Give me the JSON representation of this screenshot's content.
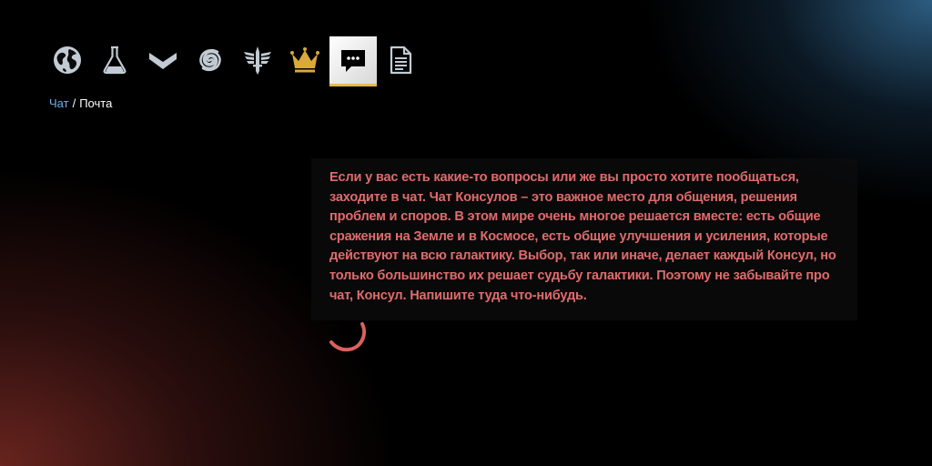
{
  "toolbar": {
    "items": [
      {
        "name": "globe-icon",
        "active": false
      },
      {
        "name": "flask-icon",
        "active": false
      },
      {
        "name": "chevron-rank-icon",
        "active": false
      },
      {
        "name": "spiral-galaxy-icon",
        "active": false
      },
      {
        "name": "winged-sword-icon",
        "active": false
      },
      {
        "name": "crown-icon",
        "active": false
      },
      {
        "name": "chat-bubble-icon",
        "active": true
      },
      {
        "name": "document-icon",
        "active": false
      }
    ],
    "active_bg": "#ffffff",
    "active_underline": "#e7b84a",
    "icon_color": "#c2cbd3",
    "crown_color": "#d9a93a"
  },
  "breadcrumb": {
    "link": "Чат",
    "separator": "/",
    "current": "Почта"
  },
  "message": {
    "text": "Если у вас есть какие-то вопросы или же вы просто хотите пообщаться, заходите в чат. Чат Консулов – это важное место для общения, решения проблем и споров. В этом мире очень многое решается вместе: есть общие сражения на Земле и в Космосе, есть общие улучшения и усиления, которые действуют на всю галактику. Выбор, так или иначе, делает каждый Консул, но только большинство их решает судьбу галактики. Поэтому не забывайте про чат, Консул. Напишите туда что-нибудь.",
    "color": "#e06b6b"
  },
  "loader": {
    "icon": "loading-spinner-icon",
    "color": "#d9625d"
  }
}
